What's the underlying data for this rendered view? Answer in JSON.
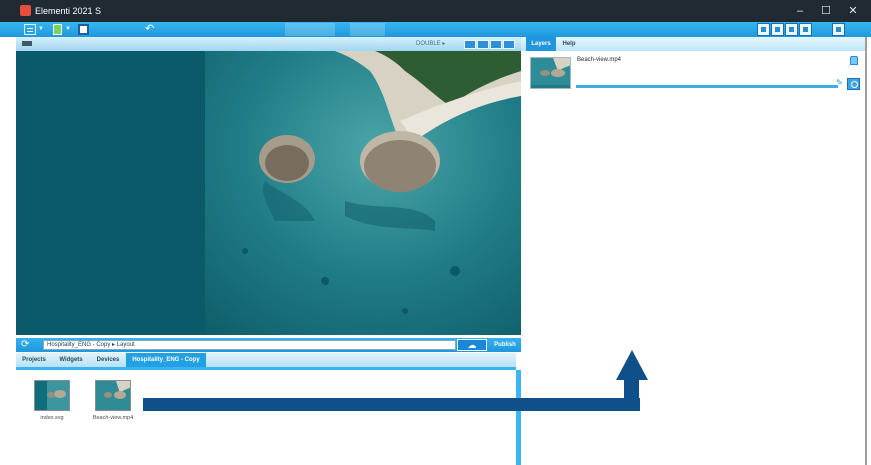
{
  "app": {
    "title": "Elementi 2021 S",
    "window_controls": [
      "–",
      "☐",
      "✕"
    ]
  },
  "toolbar": {
    "icons": [
      "layout-grid-icon",
      "new-document-icon",
      "save-icon",
      "undo-icon"
    ],
    "right_icons": [
      "display-icon",
      "monitor-icon",
      "export-icon",
      "screen-icon",
      "document-icon"
    ]
  },
  "preview": {
    "header_label": "DOUBLE ▸ ",
    "nav_icons": [
      "previous-icon",
      "play-icon",
      "stop-icon",
      "next-icon"
    ]
  },
  "path_bar": {
    "path": "Hospitality_ENG - Copy  ▸  Layout",
    "publish_label": "Publish"
  },
  "bottom_tabs": [
    {
      "label": "Projects",
      "active": false
    },
    {
      "label": "Widgets",
      "active": false
    },
    {
      "label": "Devices",
      "active": false
    },
    {
      "label": "Hospitality_ENG - Copy",
      "active": true
    }
  ],
  "files": [
    {
      "name": "index.svg"
    },
    {
      "name": "Beach-view.mp4"
    }
  ],
  "right_panel": {
    "tabs": [
      {
        "label": "Layers",
        "active": true
      },
      {
        "label": "Help",
        "active": false
      }
    ],
    "layer": {
      "name": "Beach-view.mp4",
      "progress": 1.0
    }
  },
  "colors": {
    "accent": "#1f96dd",
    "canvas_bg": "#0b5a6b",
    "arrow": "#0f4f8a"
  }
}
